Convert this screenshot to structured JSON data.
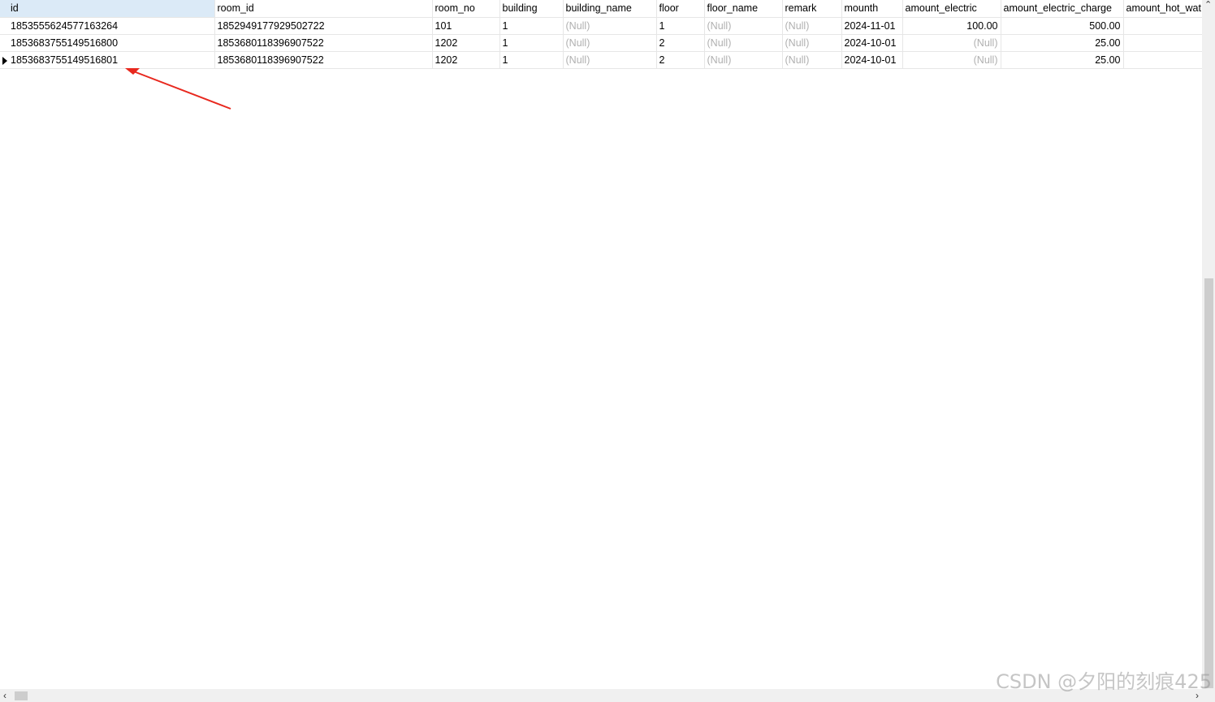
{
  "columns": [
    "id",
    "room_id",
    "room_no",
    "building",
    "building_name",
    "floor",
    "floor_name",
    "remark",
    "mounth",
    "amount_electric",
    "amount_electric_charge",
    "amount_hot_wat"
  ],
  "rows": [
    [
      "1853555624577163264",
      "1852949177929502722",
      "101",
      "1",
      "(Null)",
      "1",
      "(Null)",
      "(Null)",
      "2024-11-01",
      "100.00",
      "500.00",
      ""
    ],
    [
      "1853683755149516800",
      "1853680118396907522",
      "1202",
      "1",
      "(Null)",
      "2",
      "(Null)",
      "(Null)",
      "2024-10-01",
      "(Null)",
      "25.00",
      ""
    ],
    [
      "1853683755149516801",
      "1853680118396907522",
      "1202",
      "1",
      "(Null)",
      "2",
      "(Null)",
      "(Null)",
      "2024-10-01",
      "(Null)",
      "25.00",
      ""
    ]
  ],
  "annotation_color": "#e8281e",
  "watermark": "CSDN @夕阳的刻痕425"
}
